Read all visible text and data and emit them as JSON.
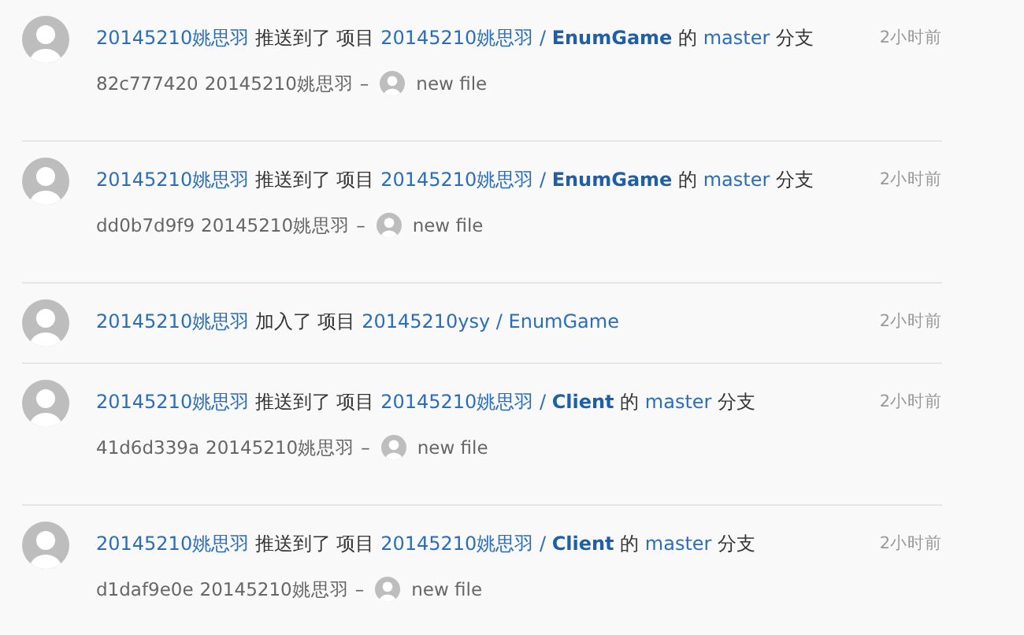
{
  "events": [
    {
      "headline": [
        {
          "kind": "link",
          "text": "20145210姚思羽"
        },
        {
          "kind": "text",
          "text": "推送到了 项目"
        },
        {
          "kind": "link",
          "text": "20145210姚思羽 / **EnumGame**"
        },
        {
          "kind": "text",
          "text": "的"
        },
        {
          "kind": "link",
          "text": "master"
        },
        {
          "kind": "text",
          "text": "分支"
        }
      ],
      "time": "2小时前",
      "commit": {
        "sha": "82c777420",
        "author": "20145210姚思羽",
        "separator": "–",
        "message": "new file"
      }
    },
    {
      "headline": [
        {
          "kind": "link",
          "text": "20145210姚思羽"
        },
        {
          "kind": "text",
          "text": "推送到了 项目"
        },
        {
          "kind": "link",
          "text": "20145210姚思羽 / **EnumGame**"
        },
        {
          "kind": "text",
          "text": "的"
        },
        {
          "kind": "link",
          "text": "master"
        },
        {
          "kind": "text",
          "text": "分支"
        }
      ],
      "time": "2小时前",
      "commit": {
        "sha": "dd0b7d9f9",
        "author": "20145210姚思羽",
        "separator": "–",
        "message": "new file"
      }
    },
    {
      "headline": [
        {
          "kind": "link",
          "text": "20145210姚思羽"
        },
        {
          "kind": "text",
          "text": "加入了 项目"
        },
        {
          "kind": "link",
          "text": "20145210ysy / EnumGame"
        }
      ],
      "time": "2小时前"
    },
    {
      "headline": [
        {
          "kind": "link",
          "text": "20145210姚思羽"
        },
        {
          "kind": "text",
          "text": "推送到了 项目"
        },
        {
          "kind": "link",
          "text": "20145210姚思羽 / **Client**"
        },
        {
          "kind": "text",
          "text": "的"
        },
        {
          "kind": "link",
          "text": "master"
        },
        {
          "kind": "text",
          "text": "分支"
        }
      ],
      "time": "2小时前",
      "commit": {
        "sha": "41d6d339a",
        "author": "20145210姚思羽",
        "separator": "–",
        "message": "new file"
      }
    },
    {
      "headline": [
        {
          "kind": "link",
          "text": "20145210姚思羽"
        },
        {
          "kind": "text",
          "text": "推送到了 项目"
        },
        {
          "kind": "link",
          "text": "20145210姚思羽 / **Client**"
        },
        {
          "kind": "text",
          "text": "的"
        },
        {
          "kind": "link",
          "text": "master"
        },
        {
          "kind": "text",
          "text": "分支"
        }
      ],
      "time": "2小时前",
      "commit": {
        "sha": "d1daf9e0e",
        "author": "20145210姚思羽",
        "separator": "–",
        "message": "new file"
      }
    }
  ]
}
